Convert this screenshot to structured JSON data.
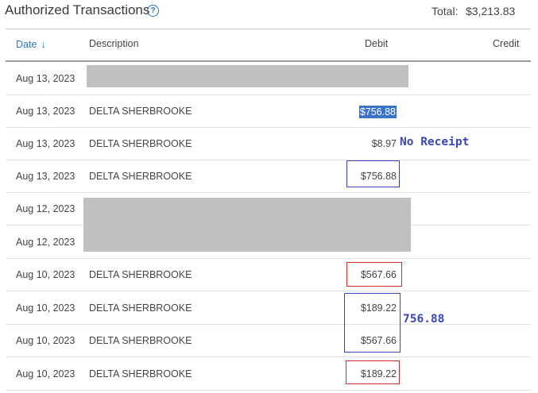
{
  "header": {
    "title": "Authorized Transactions",
    "help_icon": "question-circle-icon",
    "total_label": "Total:",
    "total_value": "$3,213.83"
  },
  "columns": {
    "date": "Date",
    "date_sort_icon": "arrow-down-icon",
    "description": "Description",
    "debit": "Debit",
    "credit": "Credit"
  },
  "rows": [
    {
      "date": "Aug 13, 2023",
      "description": "",
      "debit": "",
      "redacted": true
    },
    {
      "date": "Aug 13, 2023",
      "description": "DELTA SHERBROOKE",
      "debit": "$756.88",
      "highlighted": true
    },
    {
      "date": "Aug 13, 2023",
      "description": "DELTA SHERBROOKE",
      "debit": "$8.97"
    },
    {
      "date": "Aug 13, 2023",
      "description": "DELTA SHERBROOKE",
      "debit": "$756.88"
    },
    {
      "date": "Aug 12, 2023",
      "description": "",
      "debit": "",
      "redacted": true
    },
    {
      "date": "Aug 12, 2023",
      "description": "",
      "debit": "",
      "redacted": true
    },
    {
      "date": "Aug 10, 2023",
      "description": "DELTA SHERBROOKE",
      "debit": "$567.66"
    },
    {
      "date": "Aug 10, 2023",
      "description": "DELTA SHERBROOKE",
      "debit": "$189.22"
    },
    {
      "date": "Aug 10, 2023",
      "description": "DELTA SHERBROOKE",
      "debit": "$567.66"
    },
    {
      "date": "Aug 10, 2023",
      "description": "DELTA SHERBROOKE",
      "debit": "$189.22"
    }
  ],
  "annotations": {
    "no_receipt": "No Receipt",
    "sum_note": "756.88",
    "blue_color": "#3a46b8",
    "red_color": "#d12a2a"
  }
}
